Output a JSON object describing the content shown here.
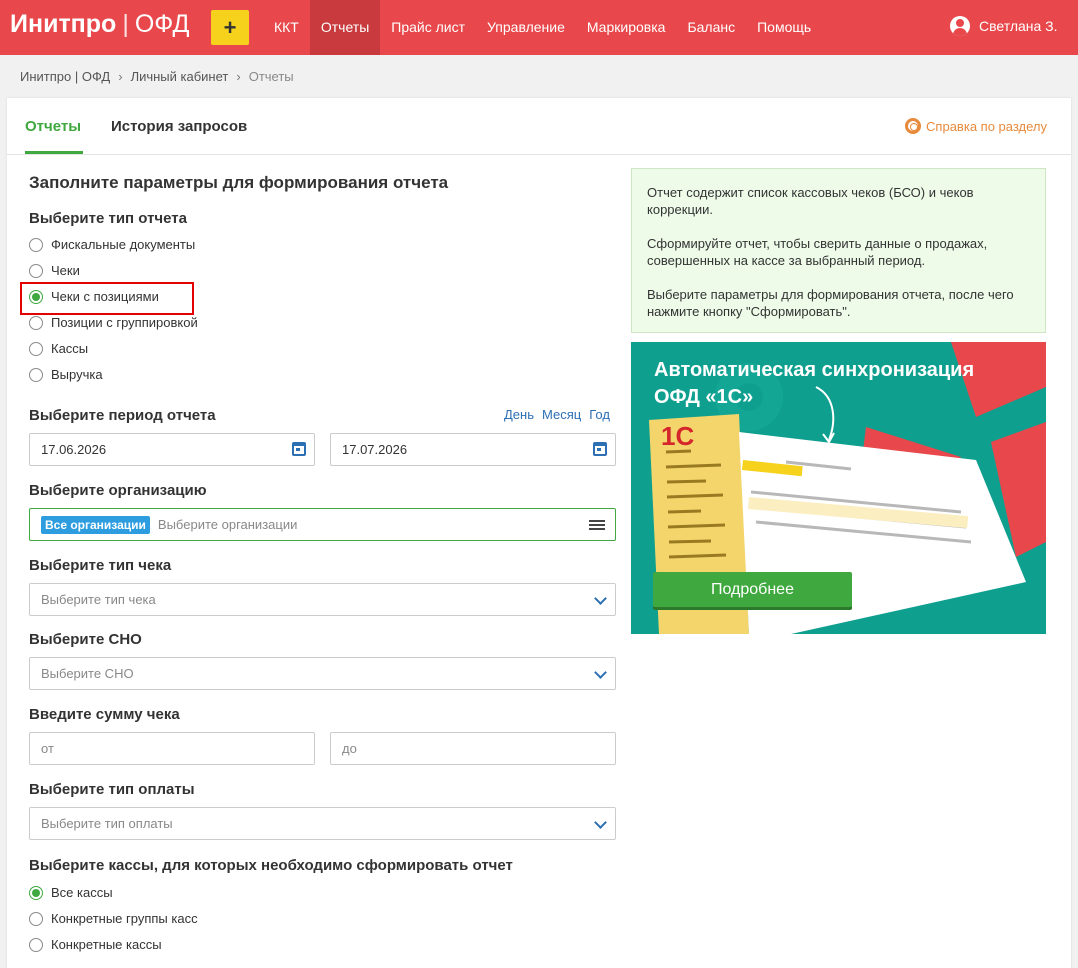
{
  "header": {
    "logo_main": "Инитпро",
    "logo_sep": "|",
    "logo_sub": "ОФД",
    "plus_label": "+",
    "nav": [
      {
        "label": "ККТ"
      },
      {
        "label": "Отчеты",
        "active": true
      },
      {
        "label": "Прайс лист"
      },
      {
        "label": "Управление"
      },
      {
        "label": "Маркировка"
      },
      {
        "label": "Баланс"
      },
      {
        "label": "Помощь"
      }
    ],
    "user_name": "Светлана З.",
    "user_icon": "user-circle-icon",
    "bar_color": "#e8484b"
  },
  "breadcrumbs": {
    "items": [
      "Инитпро | ОФД",
      "Личный кабинет",
      "Отчеты"
    ],
    "separator": "›"
  },
  "tabs": {
    "items": [
      {
        "label": "Отчеты",
        "active": true
      },
      {
        "label": "История запросов"
      }
    ],
    "help_label": "Справка по разделу",
    "help_icon": "lifebuoy-icon"
  },
  "form": {
    "heading": "Заполните параметры для формирования отчета",
    "report_type": {
      "label": "Выберите тип отчета",
      "options": [
        {
          "label": "Фискальные документы",
          "selected": false
        },
        {
          "label": "Чеки",
          "selected": false
        },
        {
          "label": "Чеки с позициями",
          "selected": true
        },
        {
          "label": "Позиции с группировкой",
          "selected": false
        },
        {
          "label": "Кассы",
          "selected": false
        },
        {
          "label": "Выручка",
          "selected": false
        }
      ]
    },
    "period": {
      "label": "Выберите период отчета",
      "quick": [
        "День",
        "Месяц",
        "Год"
      ],
      "date_from": "17.06.2026",
      "date_to": "17.07.2026"
    },
    "organization": {
      "label": "Выберите организацию",
      "tag": "Все организации",
      "placeholder": "Выберите организации"
    },
    "check_type": {
      "label": "Выберите тип чека",
      "placeholder": "Выберите тип чека"
    },
    "sno": {
      "label": "Выберите СНО",
      "placeholder": "Выберите СНО"
    },
    "amount": {
      "label": "Введите сумму чека",
      "from_placeholder": "от",
      "to_placeholder": "до"
    },
    "payment_type": {
      "label": "Выберите тип оплаты",
      "placeholder": "Выберите тип оплаты"
    },
    "kkt_scope": {
      "label": "Выберите кассы, для которых необходимо сформировать отчет",
      "options": [
        {
          "label": "Все кассы",
          "selected": true
        },
        {
          "label": "Конкретные группы касс",
          "selected": false
        },
        {
          "label": "Конкретные кассы",
          "selected": false
        }
      ]
    }
  },
  "info": {
    "paragraphs": [
      "Отчет содержит список кассовых чеков (БСО) и чеков коррекции.",
      "Сформируйте отчет, чтобы сверить данные о продажах, совершенных на кассе за выбранный период.",
      "Выберите параметры для формирования отчета, после чего нажмите кнопку \"Сформировать\"."
    ]
  },
  "banner": {
    "title_line1": "Автоматическая синхронизация",
    "title_line2": "ОФД «1С»",
    "logo_text": "1С",
    "button_label": "Подробнее"
  },
  "colors": {
    "accent_green": "#3fa83f",
    "link_blue": "#2d6fb3",
    "help_orange": "#e88a3b",
    "banner_teal": "#0f9f8f",
    "highlight_red": "#e30000"
  }
}
